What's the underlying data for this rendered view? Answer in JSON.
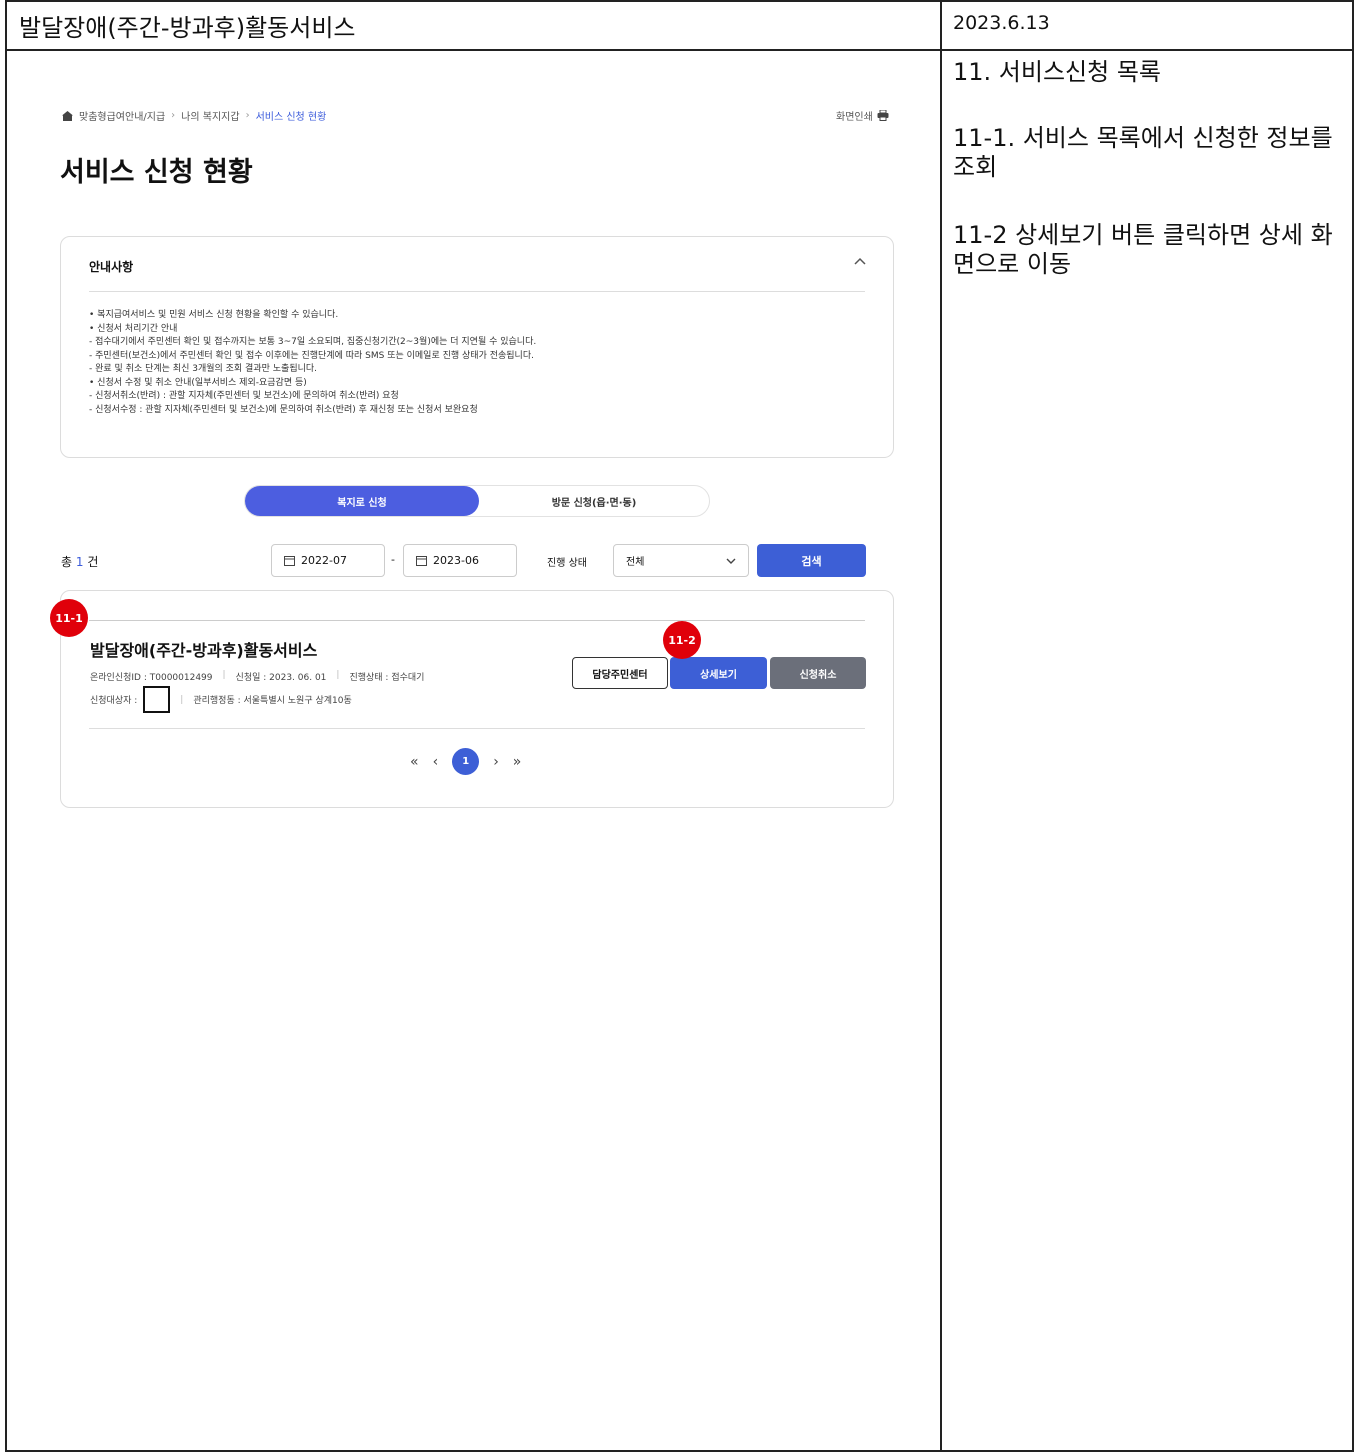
{
  "doc": {
    "title": "발달장애(주간-방과후)활동서비스",
    "date": "2023.6.13",
    "desc_title": "11. 서비스신청 목록",
    "desc_1": "11-1. 서비스 목록에서 신청한 정보를 조회",
    "desc_2": "11-2 상세보기 버튼 클릭하면 상세 화면으로 이동"
  },
  "breadcrumb": [
    "맞춤형급여안내/지급",
    "나의 복지지갑",
    "서비스 신청 현황"
  ],
  "print_label": "화면인쇄",
  "page_title": "서비스 신청 현황",
  "notice": {
    "heading": "안내사항",
    "lines": [
      "• 복지급여서비스 및 민원 서비스 신청 현황을 확인할 수 있습니다.",
      "• 신청서 처리기간 안내",
      "  - 접수대기에서 주민센터 확인 및 접수까지는 보통 3~7일 소요되며, 집중신청기간(2~3월)에는 더 지연될 수 있습니다.",
      "  - 주민센터(보건소)에서 주민센터 확인 및 접수 이후에는 진행단계에 따라 SMS 또는 이메일로 진행 상태가 전송됩니다.",
      "  - 완료 및 취소 단계는 최신 3개월의 조회 결과만 노출됩니다.",
      "• 신청서 수정 및 취소 안내(일부서비스 제외-요금감면 등)",
      "  - 신청서취소(반려) : 관할 지자체(주민센터 및 보건소)에 문의하여 취소(반려) 요청",
      "  - 신청서수정 : 관할 지자체(주민센터 및 보건소)에 문의하여 취소(반려) 후 재신청 또는 신청서 보완요청"
    ]
  },
  "tabs": {
    "active": "복지로 신청",
    "inactive": "방문 신청(읍·면·동)"
  },
  "filter": {
    "total_prefix": "총",
    "total_count": "1",
    "total_suffix": "건",
    "date_from": "2022-07",
    "date_sep": "-",
    "date_to": "2023-06",
    "status_label": "진행 상태",
    "status_value": "전체",
    "search_label": "검색"
  },
  "item": {
    "name": "발달장애(주간-방과후)활동서비스",
    "online_id": "온라인신청ID : T0000012499",
    "apply_date": "신청일 : 2023. 06. 01",
    "progress": "진행상태 : 접수대기",
    "target_label": "신청대상자 :",
    "office": "관리행정동 : 서울특별시 노원구 상계10동",
    "btn_center": "담당주민센터",
    "btn_detail": "상세보기",
    "btn_cancel": "신청취소"
  },
  "pager": {
    "first": "«",
    "prev": "‹",
    "current": "1",
    "next": "›",
    "last": "»"
  },
  "badges": {
    "b1": "11-1",
    "b2": "11-2"
  },
  "colors": {
    "accent": "#3d5fd6",
    "badge": "#e0000a",
    "cancel": "#6b6f7a"
  }
}
